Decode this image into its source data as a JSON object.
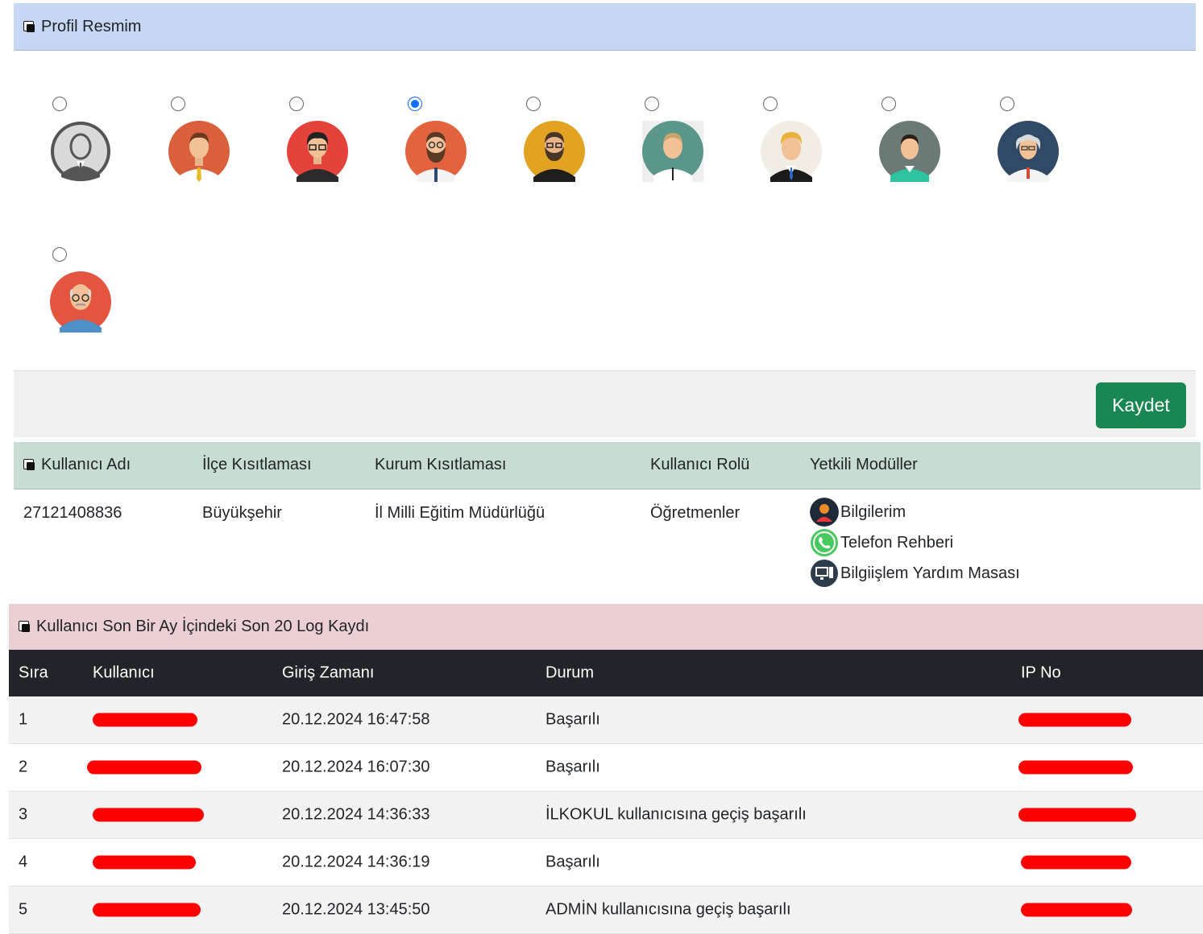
{
  "profile": {
    "title": "Profil Resmim",
    "selected_index": 3,
    "avatars": [
      {
        "icon": "avatar-gray-man-icon"
      },
      {
        "icon": "avatar-orange-man-icon"
      },
      {
        "icon": "avatar-red-glasses-man-icon"
      },
      {
        "icon": "avatar-bearded-man-icon"
      },
      {
        "icon": "avatar-yellow-bearded-man-icon"
      },
      {
        "icon": "avatar-teal-man-icon"
      },
      {
        "icon": "avatar-blonde-man-icon"
      },
      {
        "icon": "avatar-green-man-icon"
      },
      {
        "icon": "avatar-old-scientist-icon"
      },
      {
        "icon": "avatar-old-man-glasses-icon"
      }
    ],
    "save_label": "Kaydet"
  },
  "user_table": {
    "headers": {
      "username": "Kullanıcı Adı",
      "district": "İlçe Kısıtlaması",
      "institution": "Kurum Kısıtlaması",
      "role": "Kullanıcı Rolü",
      "modules": "Yetkili Modüller"
    },
    "row": {
      "username": "27121408836",
      "district": "Büyükşehir",
      "institution": "İl Milli Eğitim Müdürlüğü",
      "role": "Öğretmenler",
      "modules": [
        {
          "label": "Bilgilerim",
          "icon": "user-profile-icon"
        },
        {
          "label": "Telefon Rehberi",
          "icon": "phone-whatsapp-icon"
        },
        {
          "label": "Bilgiişlem Yardım Masası",
          "icon": "computer-support-icon"
        }
      ]
    }
  },
  "log": {
    "title": "Kullanıcı Son Bir Ay İçindeki Son 20 Log Kaydı",
    "headers": {
      "index": "Sıra",
      "user": "Kullanıcı",
      "time": "Giriş Zamanı",
      "status": "Durum",
      "ip": "IP No"
    },
    "rows": [
      {
        "index": "1",
        "time": "20.12.2024 16:47:58",
        "status": "Başarılı"
      },
      {
        "index": "2",
        "time": "20.12.2024 16:07:30",
        "status": "Başarılı"
      },
      {
        "index": "3",
        "time": "20.12.2024 14:36:33",
        "status": "İLKOKUL kullanıcısına geçiş başarılı"
      },
      {
        "index": "4",
        "time": "20.12.2024 14:36:19",
        "status": "Başarılı"
      },
      {
        "index": "5",
        "time": "20.12.2024 13:45:50",
        "status": "ADMİN kullanıcısına geçiş başarılı"
      }
    ],
    "redaction_color": "#ff0000"
  }
}
